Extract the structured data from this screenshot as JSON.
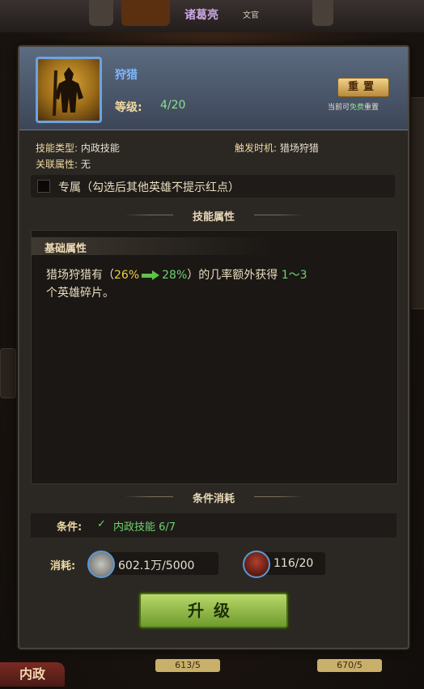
{
  "top": {
    "hero_name": "诸葛亮",
    "hero_role": "文官"
  },
  "skill": {
    "name": "狩猎",
    "level_label": "等级:",
    "level_value": "4/20",
    "reset_label": "重置",
    "reset_note_pre": "当前可",
    "reset_note_free": "免费",
    "reset_note_post": "重置",
    "type_label": "技能类型:",
    "type_value": "内政技能",
    "trigger_label": "触发时机:",
    "trigger_value": "猎场狩猎",
    "related_label": "关联属性:",
    "related_value": "无",
    "exclusive_text": "专属（勾选后其他英雄不提示红点）"
  },
  "attributes": {
    "section_title": "技能属性",
    "base_title": "基础属性",
    "desc_pre": "猎场狩猎有（",
    "rate_from": "26%",
    "rate_to": "28%",
    "desc_mid": "）的几率额外获得",
    "reward_range": "1～3",
    "desc_post": "个英雄碎片。"
  },
  "cost": {
    "section_title": "条件消耗",
    "condition_label": "条件:",
    "condition_check": "✓",
    "condition_text": "内政技能 6/7",
    "cost_label": "消耗:",
    "silver_value": "602.1万/5000",
    "fragment_value": "116/20"
  },
  "upgrade_label": "升级",
  "bottom": {
    "tab_label": "内政",
    "bar1": "613/5",
    "bar2": "670/5"
  },
  "colors": {
    "accent_green": "#6ed46e",
    "accent_yellow": "#f0d040",
    "name_blue": "#7fb8ff"
  }
}
